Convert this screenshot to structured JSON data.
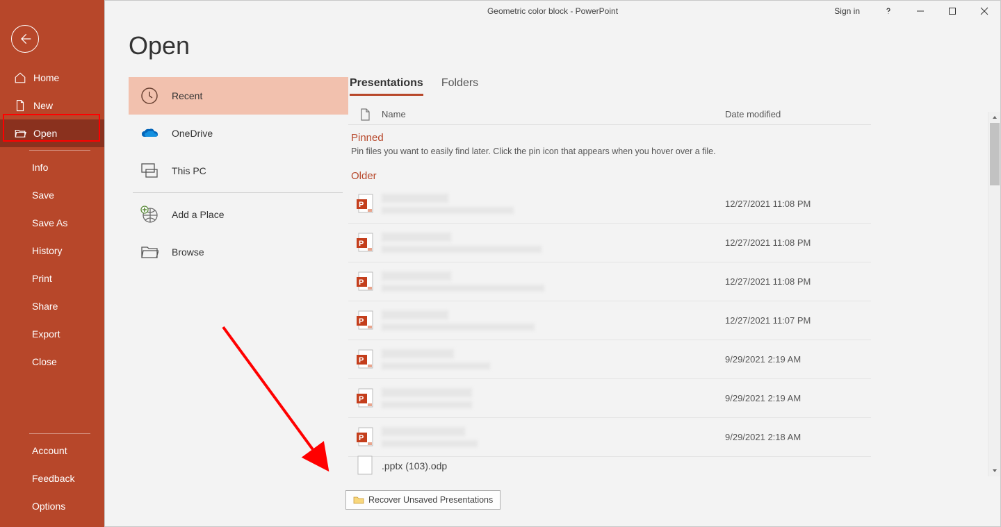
{
  "titlebar": {
    "title": "Geometric color block  -  PowerPoint",
    "signin": "Sign in"
  },
  "page": {
    "title": "Open"
  },
  "sidebar": {
    "home": "Home",
    "new": "New",
    "open": "Open",
    "info": "Info",
    "save": "Save",
    "save_as": "Save As",
    "history": "History",
    "print": "Print",
    "share": "Share",
    "export": "Export",
    "close": "Close",
    "account": "Account",
    "feedback": "Feedback",
    "options": "Options"
  },
  "sources": {
    "recent": "Recent",
    "onedrive": "OneDrive",
    "this_pc": "This PC",
    "add_place": "Add a Place",
    "browse": "Browse"
  },
  "tabs": {
    "presentations": "Presentations",
    "folders": "Folders"
  },
  "file_header": {
    "name": "Name",
    "date": "Date modified"
  },
  "sections": {
    "pinned": "Pinned",
    "pin_hint": "Pin files you want to easily find later. Click the pin icon that appears when you hover over a file.",
    "older": "Older"
  },
  "files": [
    {
      "date": "12/27/2021 11:08 PM"
    },
    {
      "date": "12/27/2021 11:08 PM"
    },
    {
      "date": "12/27/2021 11:08 PM"
    },
    {
      "date": "12/27/2021 11:07 PM"
    },
    {
      "date": "9/29/2021 2:19 AM"
    },
    {
      "date": "9/29/2021 2:19 AM"
    },
    {
      "date": "9/29/2021 2:18 AM"
    }
  ],
  "half_file": ".pptx (103).odp",
  "recover": "Recover Unsaved Presentations"
}
